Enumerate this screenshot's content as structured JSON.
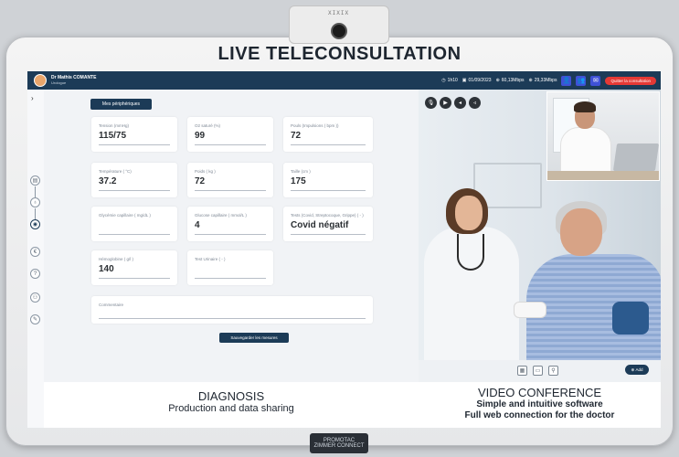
{
  "headline": "LIVE TELECONSULTATION",
  "camera_dots": "XIXIX",
  "brand": {
    "line1": "PROMOTAC",
    "line2": "ZIMMER CONNECT"
  },
  "topbar": {
    "doctor_name": "Dr Mathis COMANTE",
    "doctor_role": "Urologue",
    "stats": [
      {
        "icon": "clock-icon",
        "text": "1h10"
      },
      {
        "icon": "calendar-icon",
        "text": "01/09/2023"
      },
      {
        "icon": "download-icon",
        "text": "60,13Mbps"
      },
      {
        "icon": "upload-icon",
        "text": "29,33Mbps"
      }
    ],
    "quit_label": "Quitter la consultation"
  },
  "panel": {
    "peripherals_button": "Mes périphériques",
    "fields": [
      {
        "label": "Tension (mmHg)",
        "value": "115/75"
      },
      {
        "label": "O2 saturé (%)",
        "value": "99"
      },
      {
        "label": "Pouls (Impulsions ( bpm ))",
        "value": "72"
      },
      {
        "label": "Température ( °C)",
        "value": "37.2"
      },
      {
        "label": "Poids ( kg )",
        "value": "72"
      },
      {
        "label": "Taille (cm )",
        "value": "175"
      },
      {
        "label": "Glycémie capillaire ( mg/dL )",
        "value": ""
      },
      {
        "label": "Glucose capillaire ( mmol/L )",
        "value": "4"
      },
      {
        "label": "Tests (Covid, Streptocoque, Grippe) ( - )",
        "value": "Covid négatif"
      },
      {
        "label": "Hémoglobine ( g/l )",
        "value": "140"
      },
      {
        "label": "Test Urinaire ( - )",
        "value": ""
      }
    ],
    "comment_label": "Commentaire",
    "save_button": "Sauvegarder les mesures"
  },
  "video": {
    "add_label": "Add"
  },
  "captions": {
    "left_title": "DIAGNOSIS",
    "left_sub": "Production and data sharing",
    "right_title": "VIDEO CONFERENCE",
    "right_sub1": "Simple and intuitive software",
    "right_sub2": "Full web connection for the doctor"
  },
  "colors": {
    "topbar": "#1c3b57",
    "quit": "#e53935",
    "accent": "#3f51d6"
  }
}
